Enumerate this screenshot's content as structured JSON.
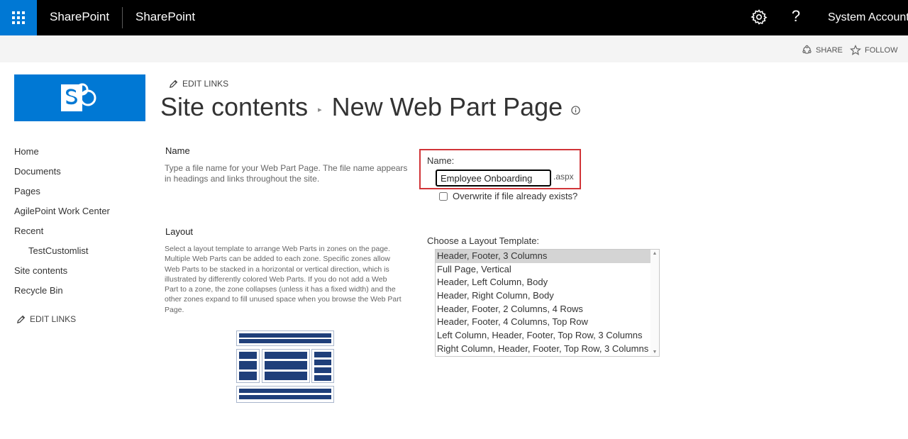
{
  "suite": {
    "brand": "SharePoint",
    "site_name": "SharePoint",
    "account": "System Account",
    "help_glyph": "?"
  },
  "actions": {
    "share": "SHARE",
    "follow": "FOLLOW"
  },
  "edit_links": "EDIT LINKS",
  "breadcrumb": {
    "parent": "Site contents",
    "current": "New Web Part Page"
  },
  "leftnav": {
    "items": [
      {
        "label": "Home"
      },
      {
        "label": "Documents"
      },
      {
        "label": "Pages"
      },
      {
        "label": "AgilePoint Work Center"
      },
      {
        "label": "Recent"
      },
      {
        "label": "TestCustomlist"
      },
      {
        "label": "Site contents"
      },
      {
        "label": "Recycle Bin"
      }
    ],
    "edit_links": "EDIT LINKS"
  },
  "name_section": {
    "heading": "Name",
    "description": "Type a file name for your Web Part Page.  The file name appears in headings and links throughout the site.",
    "field_label": "Name:",
    "value": "Employee Onboarding",
    "extension": ".aspx",
    "overwrite_label": "Overwrite if file already exists?"
  },
  "layout_section": {
    "heading": "Layout",
    "description": "Select a layout template to arrange Web Parts in zones on the page. Multiple Web Parts can be added to each zone. Specific zones allow Web Parts to be stacked in a horizontal or vertical direction, which is illustrated by differently colored Web Parts. If you do not add a Web Part to a zone, the zone collapses (unless it has a fixed width) and the other zones expand to fill unused space when you browse the Web Part Page.",
    "list_label": "Choose a Layout Template:",
    "options": [
      "Header, Footer, 3 Columns",
      "Full Page, Vertical",
      "Header, Left Column, Body",
      "Header, Right Column, Body",
      "Header, Footer, 2 Columns, 4 Rows",
      "Header, Footer, 4 Columns, Top Row",
      "Left Column, Header, Footer, Top Row, 3 Columns",
      "Right Column, Header, Footer, Top Row, 3 Columns"
    ],
    "selected": "Header, Footer, 3 Columns"
  },
  "colors": {
    "brand_blue": "#0078d4",
    "highlight_red": "#d13438",
    "preview_blue": "#1f3f7a"
  }
}
